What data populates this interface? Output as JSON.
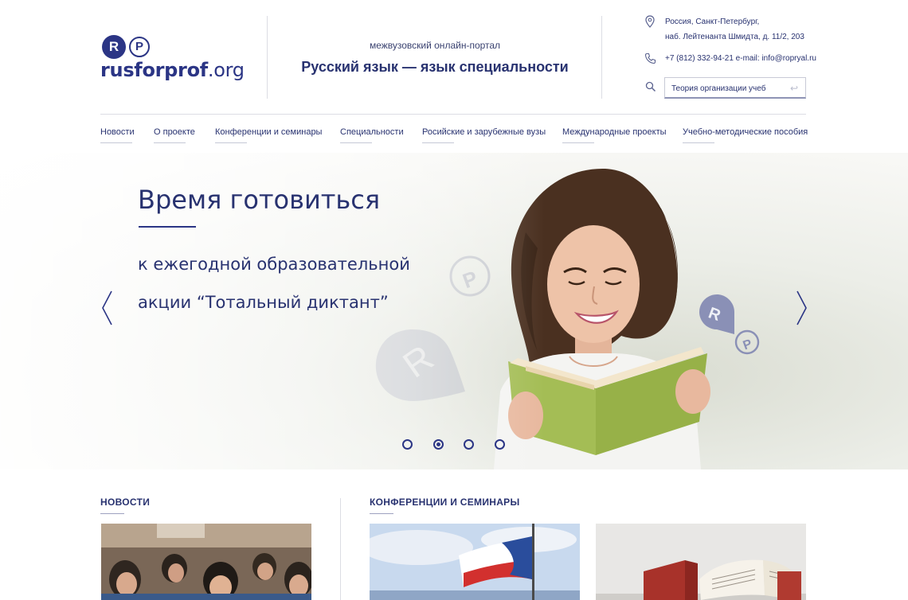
{
  "header": {
    "logo": {
      "badge_r": "R",
      "badge_p": "P",
      "name_bold": "rusforprof",
      "name_tld": ".org"
    },
    "portal_subtitle": "межвузовский онлайн-портал",
    "portal_title": "Русский язык — язык специальности",
    "address_line1": "Россия, Санкт-Петербург,",
    "address_line2": "наб. Лейтенанта Шмидта, д. 11/2, 203",
    "phone_email": "+7 (812) 332-94-21 e-mail: info@ropryal.ru",
    "search": {
      "value": "Теория организации учеб"
    },
    "icons": {
      "location": "location-pin-icon",
      "phone": "phone-icon",
      "search": "search-icon",
      "enter": "enter-icon"
    }
  },
  "nav": {
    "items": [
      {
        "label": "Новости"
      },
      {
        "label": "О проекте"
      },
      {
        "label": "Конференции и семинары"
      },
      {
        "label": "Специальности"
      },
      {
        "label": "Росийские и зарубежные вузы"
      },
      {
        "label": "Международные проекты"
      },
      {
        "label": "Учебно-методические пособия"
      }
    ]
  },
  "hero": {
    "title": "Время готовиться",
    "line1": "к ежегодной образовательной",
    "line2": "акции “Тотальный диктант”",
    "slides_count": 4,
    "active_slide": 2
  },
  "sections": {
    "news_title": "НОВОСТИ",
    "conferences_title": "КОНФЕРЕНЦИИ И СЕМИНАРЫ"
  },
  "colors": {
    "brand": "#2b3585",
    "text": "#283270",
    "line": "#dcdde4"
  }
}
